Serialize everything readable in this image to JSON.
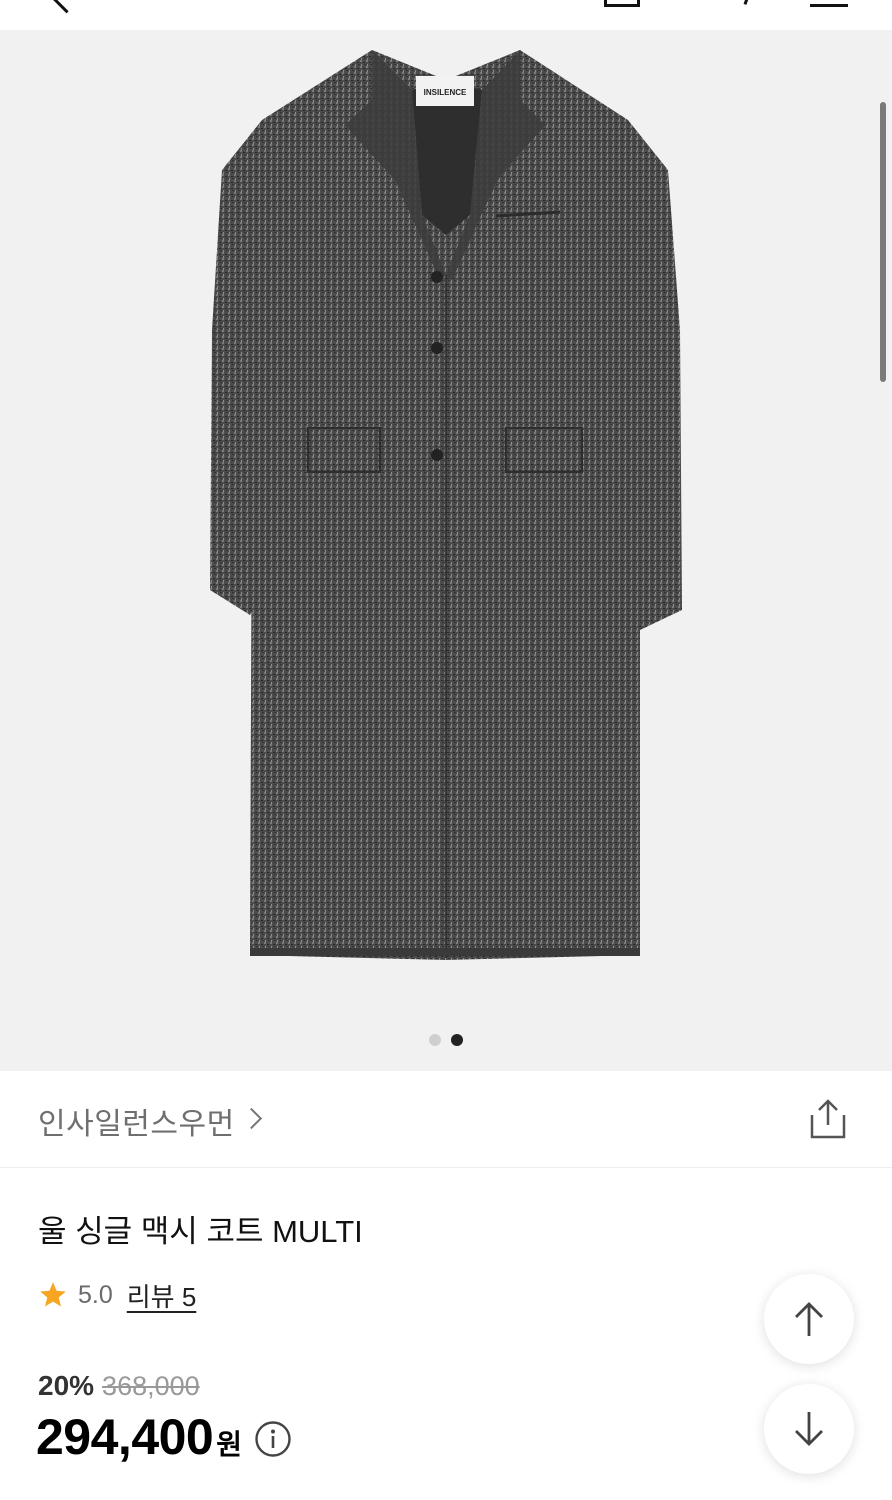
{
  "product_image": {
    "label_text": "INSILENCE",
    "dots_total": 2,
    "dots_active": 2
  },
  "brand": {
    "name": "인사일런스우먼"
  },
  "product": {
    "title": "울 싱글 맥시 코트 MULTI",
    "rating": "5.0",
    "review_label": "리뷰 5"
  },
  "price": {
    "discount": "20%",
    "original": "368,000",
    "final": "294,400",
    "currency": "원"
  },
  "icons": {
    "share": "share-icon",
    "star": "star-icon",
    "info": "info-icon",
    "scroll_up": "arrow-up-icon",
    "scroll_down": "arrow-down-icon"
  },
  "colors": {
    "star": "#F6A623",
    "gallery_bg": "#F1F1F1",
    "coat": "#4A4A4A"
  }
}
